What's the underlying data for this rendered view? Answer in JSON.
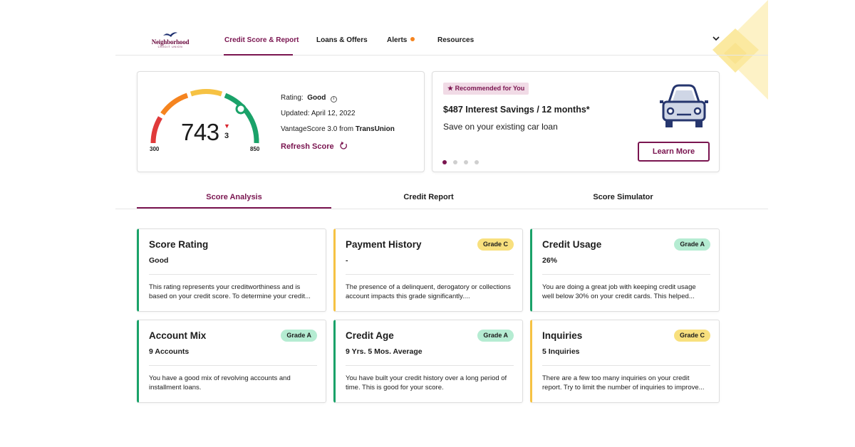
{
  "brand": {
    "name": "Neighborhood",
    "tagline": "CREDIT UNION",
    "accent_color": "#7a1550"
  },
  "nav": {
    "items": [
      {
        "label": "Credit Score & Report",
        "active": true
      },
      {
        "label": "Loans & Offers",
        "active": false
      },
      {
        "label": "Alerts",
        "active": false,
        "has_dot": true
      },
      {
        "label": "Resources",
        "active": false
      }
    ],
    "menu_icon": "chevron-down-icon"
  },
  "score": {
    "value": "743",
    "change": "3",
    "change_direction": "down",
    "min": "300",
    "max": "850",
    "rating_label": "Rating:",
    "rating_value": "Good",
    "updated": "Updated: April 12, 2022",
    "model_prefix": "VantageScore 3.0 from",
    "model_bureau": "TransUnion",
    "refresh_label": "Refresh Score"
  },
  "promo": {
    "badge": "Recommended for You",
    "title": "$487 Interest Savings / 12 months*",
    "subtitle": "Save on your existing car loan",
    "button": "Learn More",
    "slides": 4,
    "active_slide": 1,
    "icon": "car-icon"
  },
  "tabs": [
    {
      "label": "Score Analysis",
      "active": true
    },
    {
      "label": "Credit Report",
      "active": false
    },
    {
      "label": "Score Simulator",
      "active": false
    }
  ],
  "factors": [
    {
      "title": "Score Rating",
      "grade": "",
      "value": "Good",
      "description": "This rating represents your creditworthiness and is based on your credit score. To determine your credit...",
      "color": "#1aa269"
    },
    {
      "title": "Payment History",
      "grade": "Grade C",
      "value": "-",
      "description": "The presence of a delinquent, derogatory or collections account impacts this grade significantly....",
      "color": "#f6c243"
    },
    {
      "title": "Credit Usage",
      "grade": "Grade A",
      "value": "26%",
      "description": "You are doing a great job with keeping credit usage well below 30% on your credit cards. This helped...",
      "color": "#1aa269"
    },
    {
      "title": "Account Mix",
      "grade": "Grade A",
      "value": "9 Accounts",
      "description": "You have a good mix of revolving accounts and installment loans.",
      "color": "#1aa269"
    },
    {
      "title": "Credit Age",
      "grade": "Grade A",
      "value": "9 Yrs. 5 Mos. Average",
      "description": "You have built your credit history over a long period of time. This is good for your score.",
      "color": "#1aa269"
    },
    {
      "title": "Inquiries",
      "grade": "Grade C",
      "value": "5 Inquiries",
      "description": "There are a few too many inquiries on your credit report. Try to limit the number of inquiries to improve...",
      "color": "#f6c243"
    }
  ]
}
